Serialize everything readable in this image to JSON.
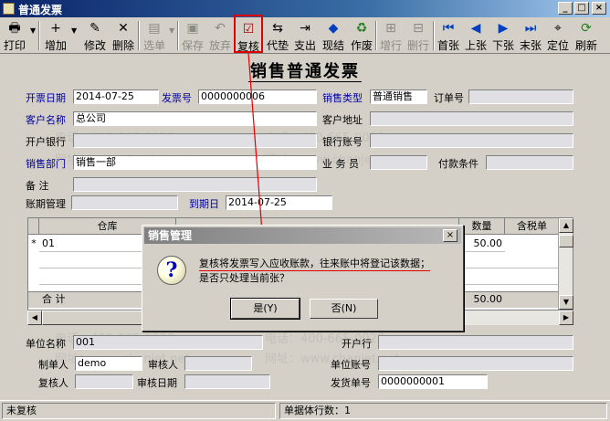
{
  "window": {
    "title": "普通发票",
    "min": "_",
    "max": "□",
    "close": "×"
  },
  "toolbar": {
    "items": [
      {
        "label": "打印",
        "icon": "🖶",
        "state": "enabled"
      },
      {
        "label": "增加",
        "icon": "+",
        "state": "enabled"
      },
      {
        "label": "修改",
        "icon": "✎",
        "state": "enabled"
      },
      {
        "label": "删除",
        "icon": "✕",
        "state": "enabled"
      },
      {
        "label": "选单",
        "icon": "▤",
        "state": "disabled"
      },
      {
        "label": "保存",
        "icon": "▣",
        "state": "disabled"
      },
      {
        "label": "放弃",
        "icon": "↶",
        "state": "disabled"
      },
      {
        "label": "复核",
        "icon": "☑",
        "state": "highlighted"
      },
      {
        "label": "代垫",
        "icon": "⇆",
        "state": "enabled"
      },
      {
        "label": "支出",
        "icon": "⇥",
        "state": "enabled"
      },
      {
        "label": "现结",
        "icon": "◆",
        "state": "enabled"
      },
      {
        "label": "作废",
        "icon": "♻",
        "state": "enabled"
      },
      {
        "label": "增行",
        "icon": "⊞",
        "state": "disabled"
      },
      {
        "label": "删行",
        "icon": "⊟",
        "state": "disabled"
      },
      {
        "label": "首张",
        "icon": "⏮",
        "state": "enabled"
      },
      {
        "label": "上张",
        "icon": "◀",
        "state": "enabled"
      },
      {
        "label": "下张",
        "icon": "▶",
        "state": "enabled"
      },
      {
        "label": "末张",
        "icon": "⏭",
        "state": "enabled"
      },
      {
        "label": "定位",
        "icon": "⌖",
        "state": "enabled"
      },
      {
        "label": "刷新",
        "icon": "⟳",
        "state": "enabled"
      }
    ]
  },
  "form": {
    "heading": "销售普通发票",
    "invoice_date_label": "开票日期",
    "invoice_date": "2014-07-25",
    "invoice_no_label": "发票号",
    "invoice_no": "0000000006",
    "sales_type_label": "销售类型",
    "sales_type": "普通销售",
    "order_no_label": "订单号",
    "order_no": "",
    "customer_label": "客户名称",
    "customer": "总公司",
    "customer_addr_label": "客户地址",
    "customer_addr": "",
    "bank_label": "开户银行",
    "bank": "",
    "bank_account_label": "银行账号",
    "bank_account": "",
    "dept_label": "销售部门",
    "dept": "销售一部",
    "salesman_label": "业 务 员",
    "salesman": "",
    "payment_terms_label": "付款条件",
    "payment_terms": "",
    "note_label": "备    注",
    "note": "",
    "aging_label": "账期管理",
    "aging": "",
    "due_date_label": "到期日",
    "due_date": "2014-07-25"
  },
  "grid": {
    "columns": [
      "仓库",
      "数量",
      "含税单"
    ],
    "rows": [
      {
        "marker": "*",
        "warehouse": "01",
        "qty": "50.00"
      }
    ],
    "total_label": "合  计",
    "total_qty": "50.00"
  },
  "footer": {
    "unit_name_label": "单位名称",
    "unit_name": "001",
    "open_bank_label": "开户行",
    "open_bank": "",
    "maker_label": "制单人",
    "maker": "demo",
    "reviewer_label": "审核人",
    "reviewer": "",
    "unit_account_label": "单位账号",
    "unit_account": "",
    "checker_label": "复核人",
    "checker": "",
    "review_date_label": "审核日期",
    "review_date": "",
    "ship_no_label": "发货单号",
    "ship_no": "0000000001"
  },
  "status": {
    "left": "未复核",
    "rows": "单据体行数：1"
  },
  "dialog": {
    "title": "销售管理",
    "line1": "复核将发票写入应收账款，往来账中将登记该数据；",
    "line2": "是否只处理当前张？",
    "yes": "是(Y)",
    "no": "否(N)",
    "close": "×"
  },
  "watermark": {
    "phone": "电话：400-665-0028",
    "site": "网址：www.chanjet.net"
  }
}
